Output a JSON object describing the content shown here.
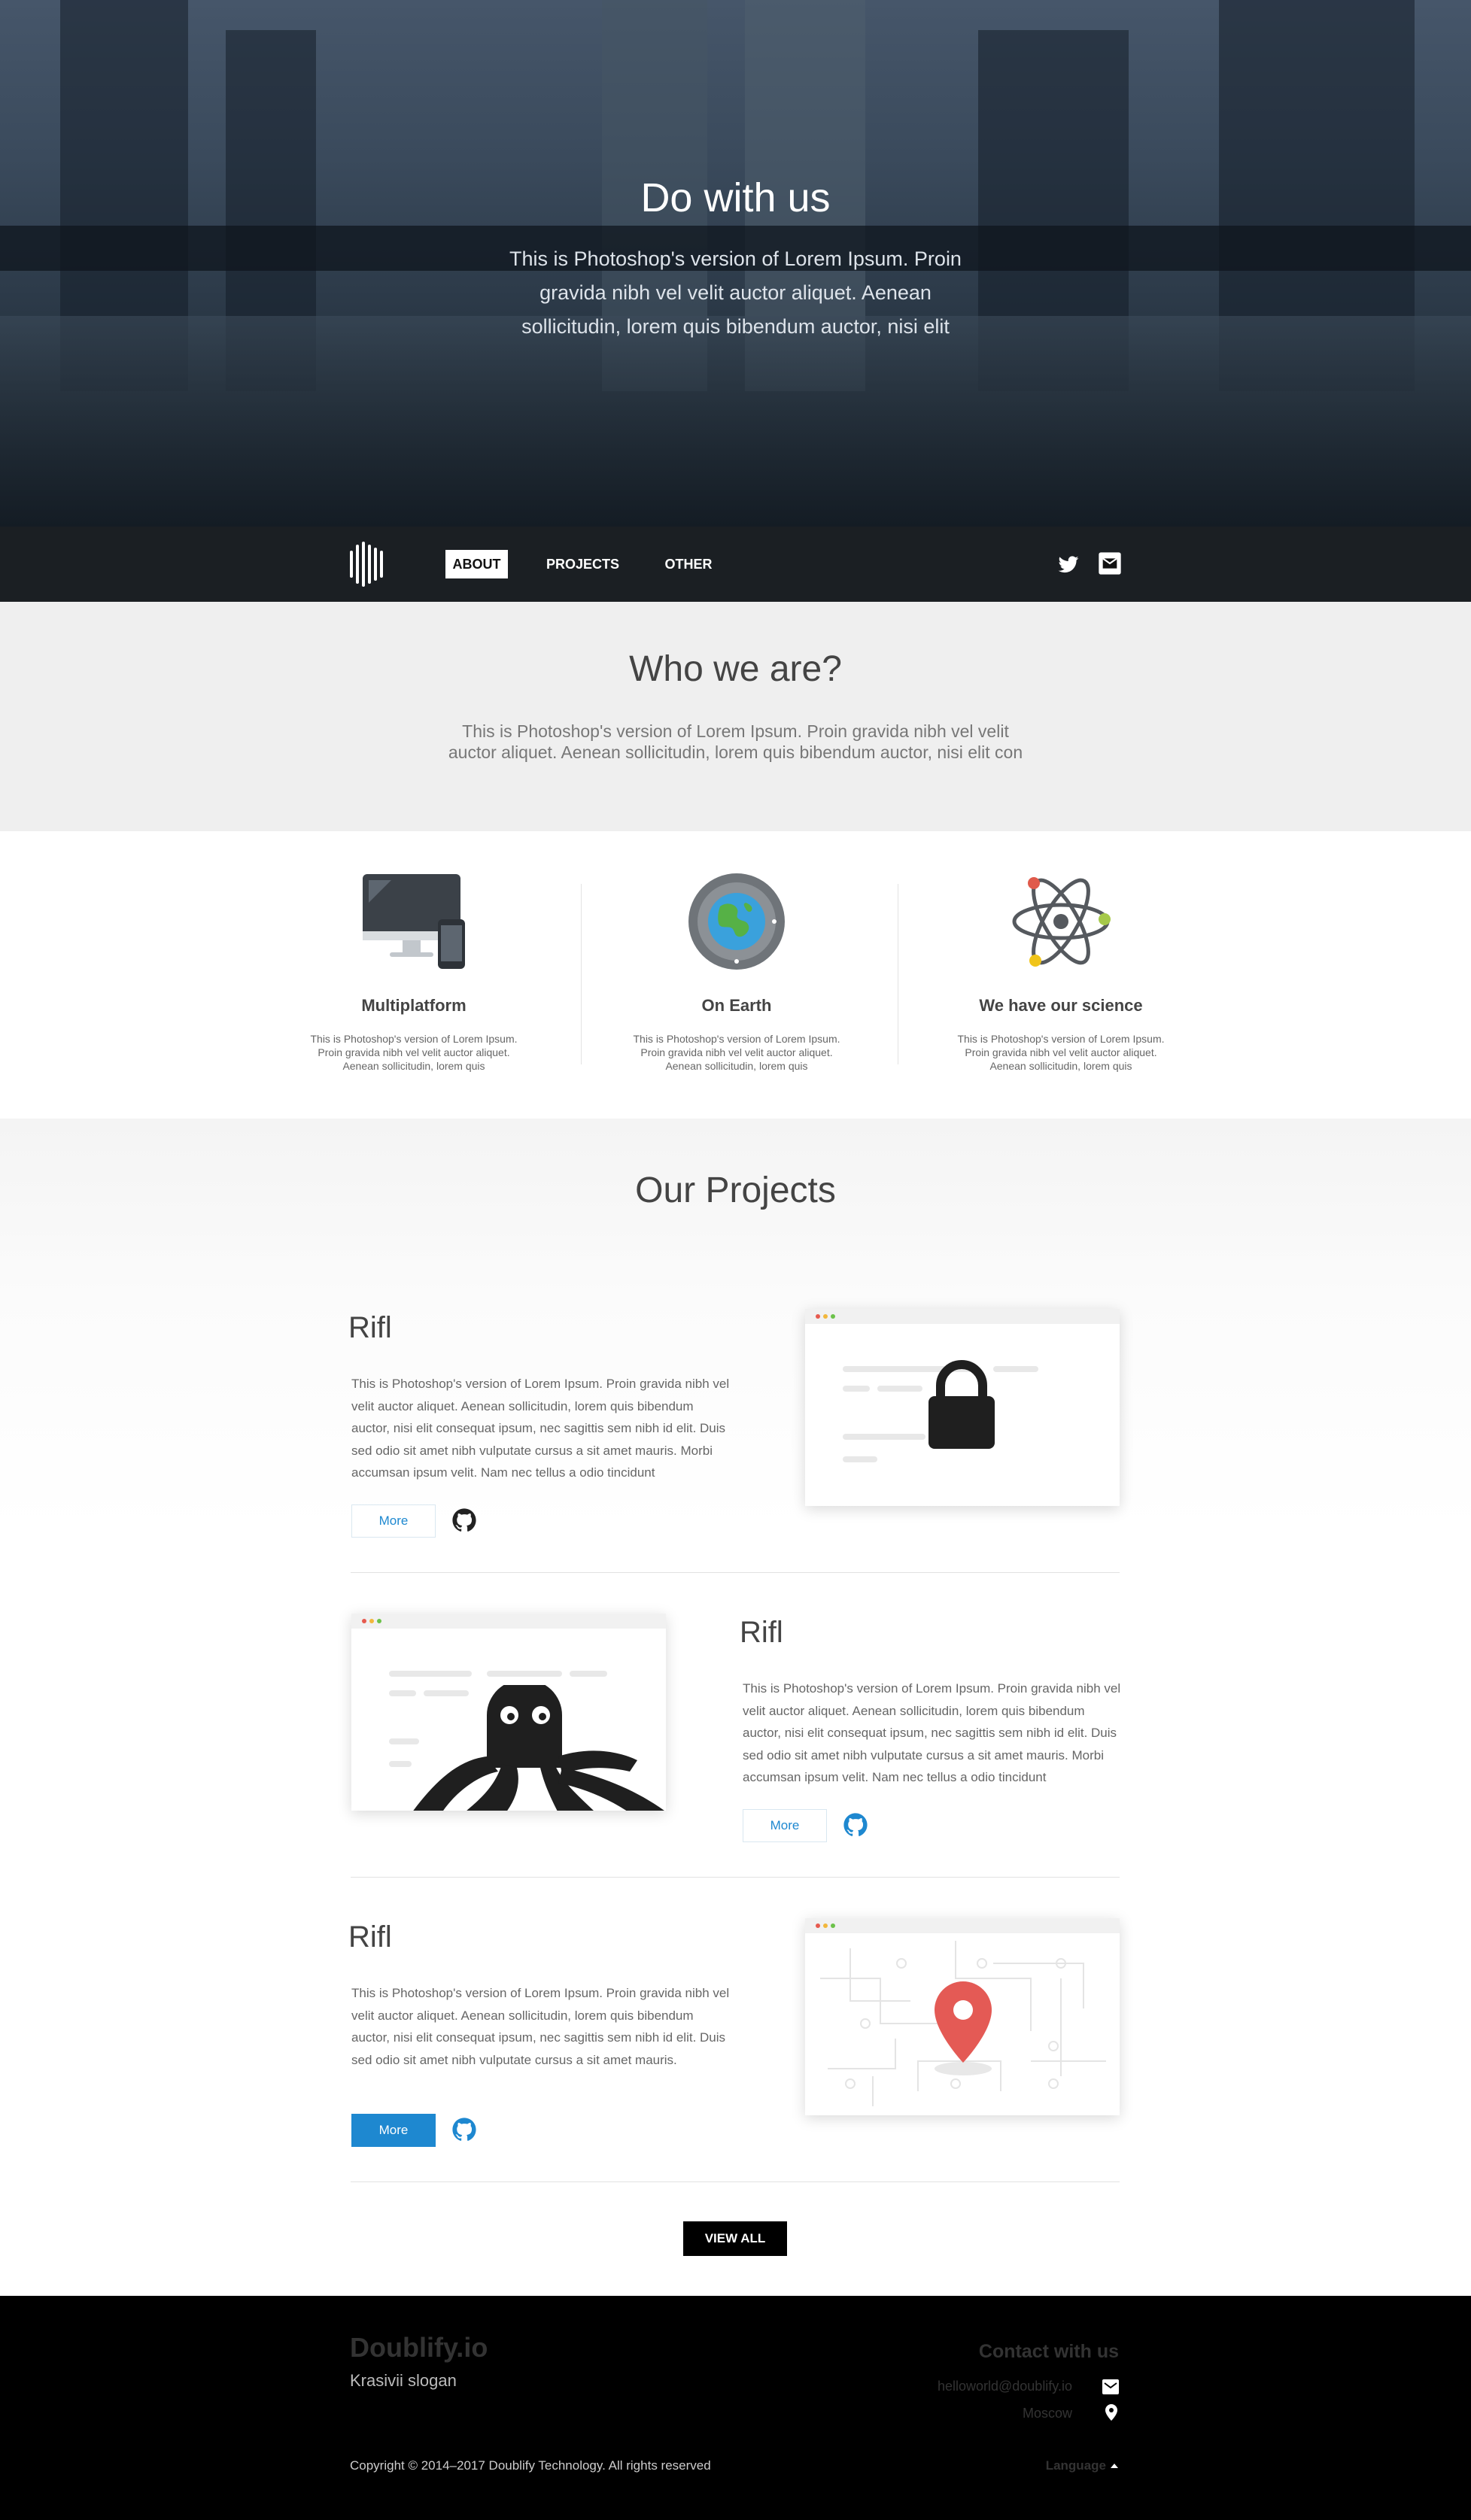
{
  "hero": {
    "title": "Do with us",
    "text": "This is Photoshop's version  of Lorem Ipsum. Proin gravida nibh vel velit auctor aliquet. Aenean sollicitudin, lorem quis bibendum auctor, nisi elit"
  },
  "nav": {
    "items": [
      {
        "label": "ABOUT",
        "active": true
      },
      {
        "label": "PROJECTS",
        "active": false
      },
      {
        "label": "OTHER",
        "active": false
      }
    ],
    "icons": [
      "twitter-icon",
      "mail-icon"
    ]
  },
  "who": {
    "title": "Who we are?",
    "text": "This is Photoshop's version  of Lorem Ipsum. Proin gravida nibh vel velit auctor aliquet. Aenean sollicitudin, lorem quis bibendum auctor, nisi elit con"
  },
  "features": [
    {
      "icon": "devices-icon",
      "title": "Multiplatform",
      "text": "This is Photoshop's version  of Lorem Ipsum. Proin gravida nibh vel velit auctor aliquet. Aenean sollicitudin, lorem quis"
    },
    {
      "icon": "earth-icon",
      "title": "On Earth",
      "text": "This is Photoshop's version  of Lorem Ipsum. Proin gravida nibh vel velit auctor aliquet. Aenean sollicitudin, lorem quis"
    },
    {
      "icon": "atom-icon",
      "title": "We have our science",
      "text": "This is Photoshop's version  of Lorem Ipsum. Proin gravida nibh vel velit auctor aliquet. Aenean sollicitudin, lorem quis"
    }
  ],
  "projects": {
    "title": "Our Projects",
    "items": [
      {
        "name": "Rifl",
        "text": "This is Photoshop's version  of Lorem Ipsum. Proin gravida nibh vel velit auctor aliquet. Aenean sollicitudin, lorem quis bibendum auctor, nisi elit consequat ipsum, nec sagittis sem nibh id elit. Duis sed odio sit amet nibh vulputate cursus a sit amet mauris. Morbi accumsan ipsum velit. Nam nec tellus a odio tincidunt",
        "more": "More",
        "image": "lock-icon"
      },
      {
        "name": "Rifl",
        "text": "This is Photoshop's version  of Lorem Ipsum. Proin gravida nibh vel velit auctor aliquet. Aenean sollicitudin, lorem quis bibendum auctor, nisi elit consequat ipsum, nec sagittis sem nibh id elit. Duis sed odio sit amet nibh vulputate cursus a sit amet mauris. Morbi accumsan ipsum velit. Nam nec tellus a odio tincidunt",
        "more": "More",
        "image": "octopus-icon"
      },
      {
        "name": "Rifl",
        "text": "This is Photoshop's version  of Lorem Ipsum. Proin gravida nibh vel velit auctor aliquet. Aenean sollicitudin, lorem quis bibendum auctor, nisi elit consequat ipsum, nec sagittis sem nibh id elit. Duis sed odio sit amet nibh vulputate cursus a sit amet mauris.",
        "more": "More",
        "image": "map-pin-icon"
      }
    ],
    "view_all": "VIEW ALL"
  },
  "footer": {
    "brand": "Doublify.io",
    "slogan": "Krasivii slogan",
    "contact_title": "Contact with us",
    "email": "helloworld@doublify.io",
    "city": "Moscow",
    "copyright": "Copyright © 2014–2017 Doublify Technology. All rights reserved",
    "language": "Language"
  },
  "colors": {
    "accent": "#1e88d0",
    "footer_bg": "#000000",
    "section_bg": "#efefef"
  }
}
